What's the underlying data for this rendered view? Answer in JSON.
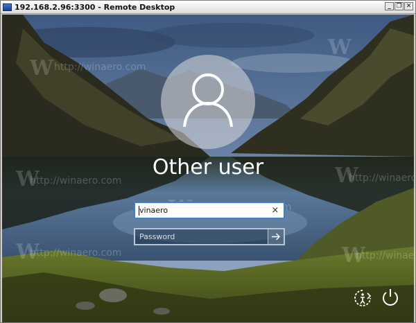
{
  "window": {
    "title": "192.168.2.96:3300 - Remote Desktop",
    "minimize_glyph": "_",
    "restore_glyph": "❐",
    "close_glyph": "✕"
  },
  "login": {
    "username_heading": "Other user",
    "username_value": "vinaero",
    "clear_glyph": "×",
    "password_placeholder": "Password"
  },
  "icons": {
    "app": "remote-desktop-icon",
    "avatar": "user-silhouette-icon",
    "submit": "arrow-right-icon",
    "ease_of_access": "ease-of-access-icon",
    "power": "power-icon"
  },
  "watermark": {
    "text": "http://winaero.com"
  },
  "colors": {
    "field_border_focus": "#3f7fd0",
    "sky": "#3a4f70",
    "water": "#5c7ca0"
  }
}
